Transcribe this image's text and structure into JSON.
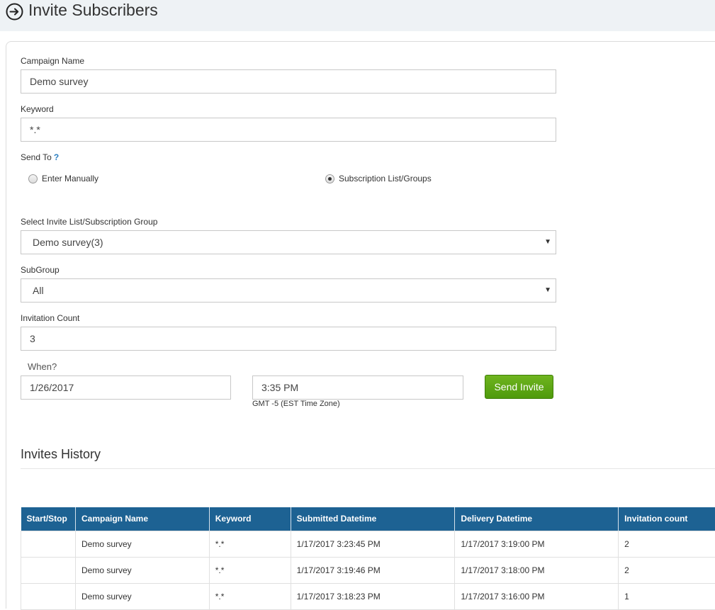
{
  "header": {
    "title": "Invite Subscribers",
    "icon": "circle-arrow-right-icon"
  },
  "form": {
    "campaign_name_label": "Campaign Name",
    "campaign_name_value": "Demo survey",
    "keyword_label": "Keyword",
    "keyword_value": "*.*",
    "send_to_label": "Send To",
    "send_to_help": "?",
    "send_to_options": [
      {
        "label": "Enter Manually",
        "selected": false
      },
      {
        "label": "Subscription List/Groups",
        "selected": true
      }
    ],
    "invite_list_label": "Select Invite List/Subscription Group",
    "invite_list_value": "Demo survey(3)",
    "subgroup_label": "SubGroup",
    "subgroup_value": "All",
    "invitation_count_label": "Invitation Count",
    "invitation_count_value": "3",
    "when_label": "When?",
    "date_value": "1/26/2017",
    "time_value": "3:35 PM",
    "timezone_note": "GMT -5 (EST Time Zone)",
    "send_button": "Send Invite"
  },
  "history": {
    "title": "Invites History",
    "columns": [
      "Start/Stop",
      "Campaign Name",
      "Keyword",
      "Submitted Datetime",
      "Delivery Datetime",
      "Invitation count"
    ],
    "rows": [
      [
        "",
        "Demo survey",
        "*.*",
        "1/17/2017 3:23:45 PM",
        "1/17/2017 3:19:00 PM",
        "2"
      ],
      [
        "",
        "Demo survey",
        "*.*",
        "1/17/2017 3:19:46 PM",
        "1/17/2017 3:18:00 PM",
        "2"
      ],
      [
        "",
        "Demo survey",
        "*.*",
        "1/17/2017 3:18:23 PM",
        "1/17/2017 3:16:00 PM",
        "1"
      ]
    ]
  },
  "colors": {
    "header_bg": "#1d6293",
    "send_button": "#5aa515",
    "topbar_bg": "#eef2f5",
    "help": "#2a7ec1"
  }
}
